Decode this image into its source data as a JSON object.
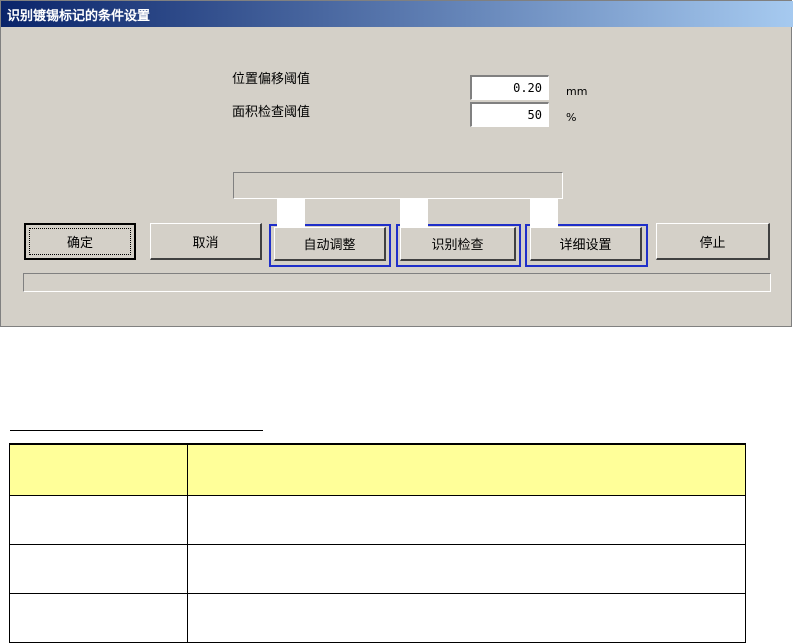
{
  "dialog": {
    "title": "识别镀锡标记的条件设置",
    "fields": [
      {
        "label": "位置偏移阈值",
        "value": "0.20",
        "unit": "mm"
      },
      {
        "label": "面积检查阈值",
        "value": "50",
        "unit": "%"
      }
    ],
    "buttons": {
      "ok": "确定",
      "cancel": "取消",
      "auto_adjust": "自动调整",
      "identify_check": "识别检查",
      "detail_settings": "详细设置",
      "stop": "停止"
    }
  },
  "table": {
    "headers": [
      "",
      ""
    ],
    "rows": [
      [
        "",
        ""
      ],
      [
        "",
        ""
      ],
      [
        "",
        ""
      ]
    ]
  }
}
